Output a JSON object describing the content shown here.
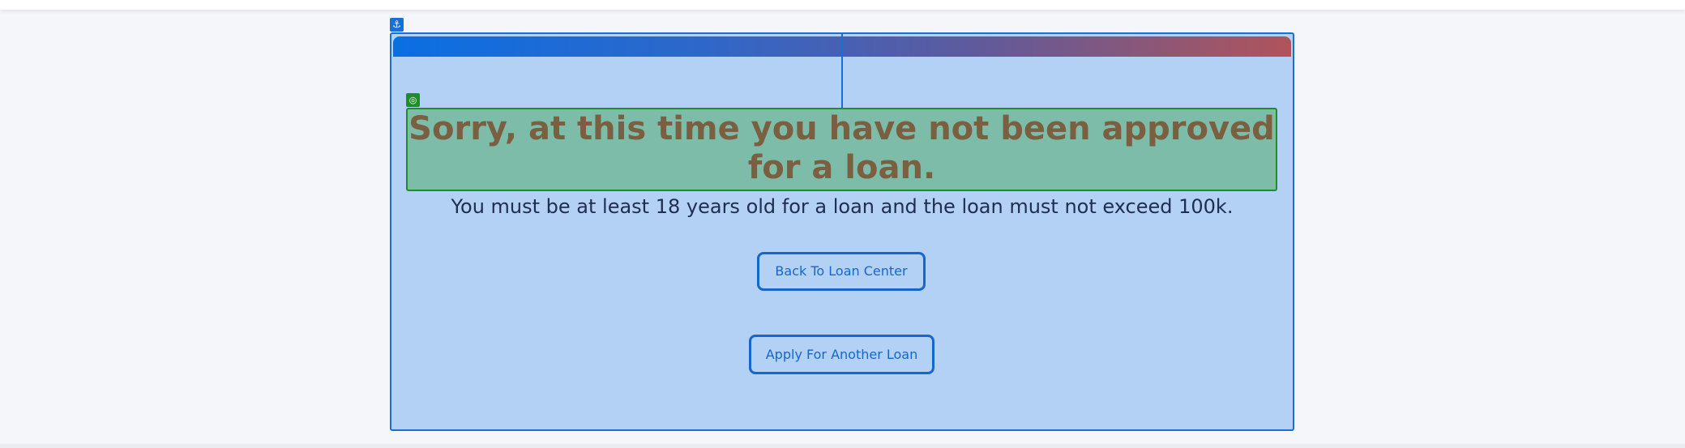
{
  "header_icons": {
    "anchor": "anchor-icon",
    "target": "target-icon"
  },
  "colors": {
    "card_background": "#b3d1f5",
    "card_border": "#1a6fd6",
    "gradient_start": "#0a6fe3",
    "gradient_end": "#b0545a",
    "heading_background": "#7ebcaa",
    "heading_border": "#1e8f28",
    "heading_text": "#7a6040",
    "button_color": "#1766cc"
  },
  "result": {
    "heading": "Sorry, at this time you have not been approved for a loan.",
    "message": "You must be at least 18 years old for a loan and the loan must not exceed 100k."
  },
  "actions": {
    "back_label": "Back To Loan Center",
    "apply_label": "Apply For Another Loan"
  }
}
